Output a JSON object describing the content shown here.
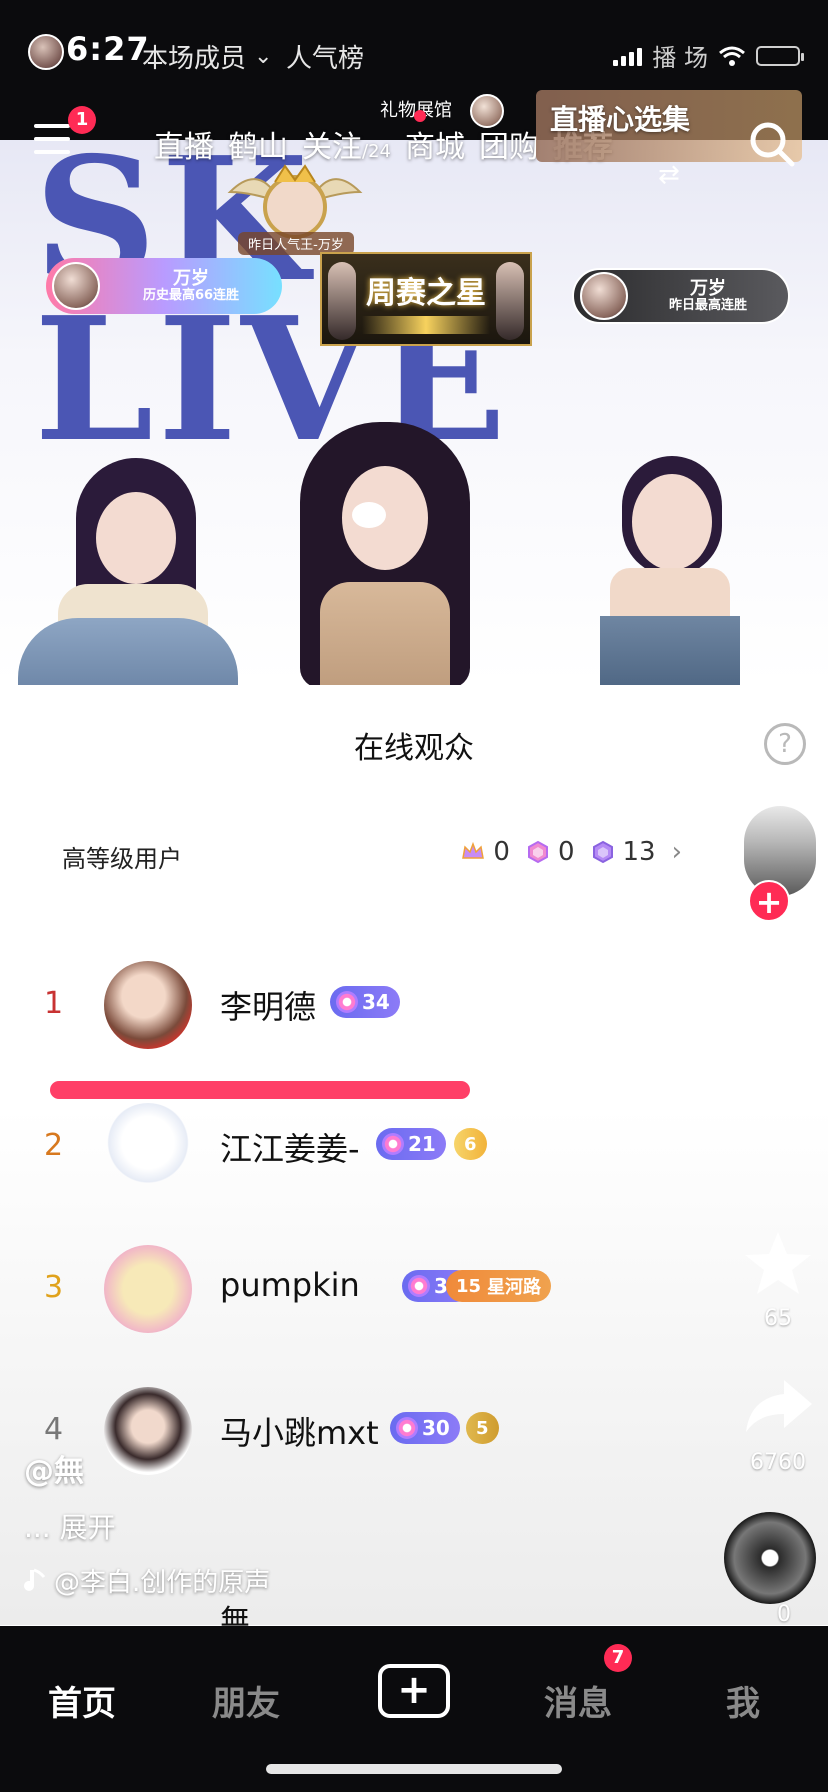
{
  "status_bar": {
    "time": "6:27",
    "members_label": "本场成员",
    "popularity_label": "人气榜",
    "right_text": "播   场"
  },
  "nav": {
    "menu_badge": "1",
    "tabs": [
      {
        "label": "直播"
      },
      {
        "label": "鹤山"
      },
      {
        "label": "关注",
        "sub": "/24"
      },
      {
        "label": "商城"
      },
      {
        "label": "团购"
      },
      {
        "label": "推荐"
      }
    ],
    "gift_label": "礼物展馆",
    "promo_title": "直播心选集"
  },
  "banner": {
    "logo_text": "SK LIVE",
    "crest_caption": "昨日人气王-万岁",
    "left_pill": {
      "name": "万岁",
      "sub": "历史最高66连胜"
    },
    "weekly_star": "周赛之星",
    "right_pill": {
      "name": "万岁",
      "sub": "昨日最高连胜"
    }
  },
  "audience": {
    "title": "在线观众",
    "help_icon": "?",
    "high_level_label": "高等级用户",
    "stats": [
      "0",
      "0",
      "13"
    ],
    "rows": [
      {
        "rank": "1",
        "name": "李明德",
        "level": "34",
        "rank_color": "#c83232"
      },
      {
        "rank": "2",
        "name": "江江姜姜-",
        "level": "21",
        "fan": "6",
        "rank_color": "#d7781e"
      },
      {
        "rank": "3",
        "name": "pumpkin",
        "level": "36",
        "fan": "15",
        "fan_label": "星河路",
        "rank_color": "#e0a21c"
      },
      {
        "rank": "4",
        "name": "马小跳mxt",
        "level": "30",
        "fan": "5",
        "rank_color": "#777777"
      }
    ],
    "partial_name": "無"
  },
  "rail": {
    "star_count": "65",
    "share_count": "6760",
    "music_count": "0"
  },
  "overlay": {
    "handle": "@無",
    "expand": "... 展开",
    "sound": "@李白.创作的原声"
  },
  "bottom_bar": {
    "home": "首页",
    "friends": "朋友",
    "add": "+",
    "messages": "消息",
    "messages_badge": "7",
    "me": "我"
  },
  "colors": {
    "accent_red": "#ff2b55",
    "underline": "#ff3f67",
    "level_badge": "#6a6bf0",
    "logo_blue": "#4b56b4"
  }
}
